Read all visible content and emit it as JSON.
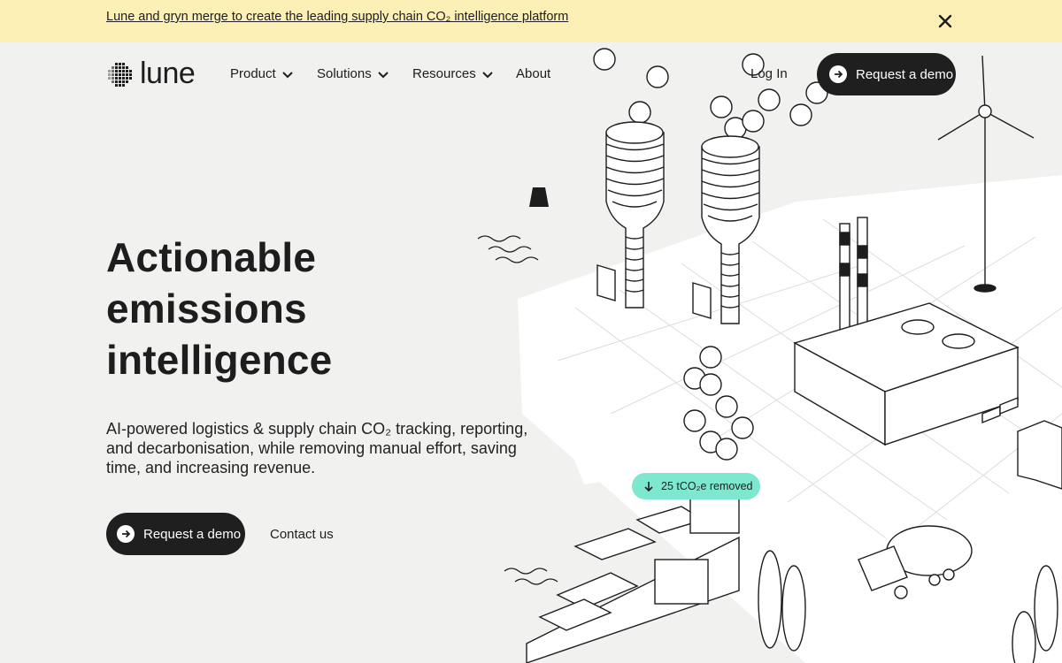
{
  "banner": {
    "text": "Lune and gryn merge to create the leading supply chain CO₂ intelligence platform"
  },
  "nav": {
    "logo_text": "lune",
    "items": [
      {
        "label": "Product",
        "has_dropdown": true
      },
      {
        "label": "Solutions",
        "has_dropdown": true
      },
      {
        "label": "Resources",
        "has_dropdown": true
      },
      {
        "label": "About",
        "has_dropdown": false
      }
    ],
    "login_label": "Log In",
    "demo_label": "Request a demo"
  },
  "hero": {
    "title_lines": [
      "Actionable",
      "emissions",
      "intelligence"
    ],
    "subtitle_lines": [
      "AI-powered logistics & supply chain CO₂ tracking, reporting,",
      "and decarbonisation, while removing manual effort, saving",
      "time, and increasing revenue."
    ],
    "cta_label": "Request a demo",
    "secondary_label": "Contact us"
  },
  "illustration": {
    "badge_text": "25 tCO₂e removed"
  },
  "colors": {
    "banner_bg": "#fcf0b6",
    "page_bg": "#f1f1f0",
    "button_dark": "#1f1f1f",
    "badge_bg": "#7ee8cf"
  },
  "icons": {
    "close": "close-icon",
    "chevron": "chevron-down-icon",
    "arrow_right": "arrow-right-icon",
    "arrow_down": "arrow-down-icon"
  }
}
